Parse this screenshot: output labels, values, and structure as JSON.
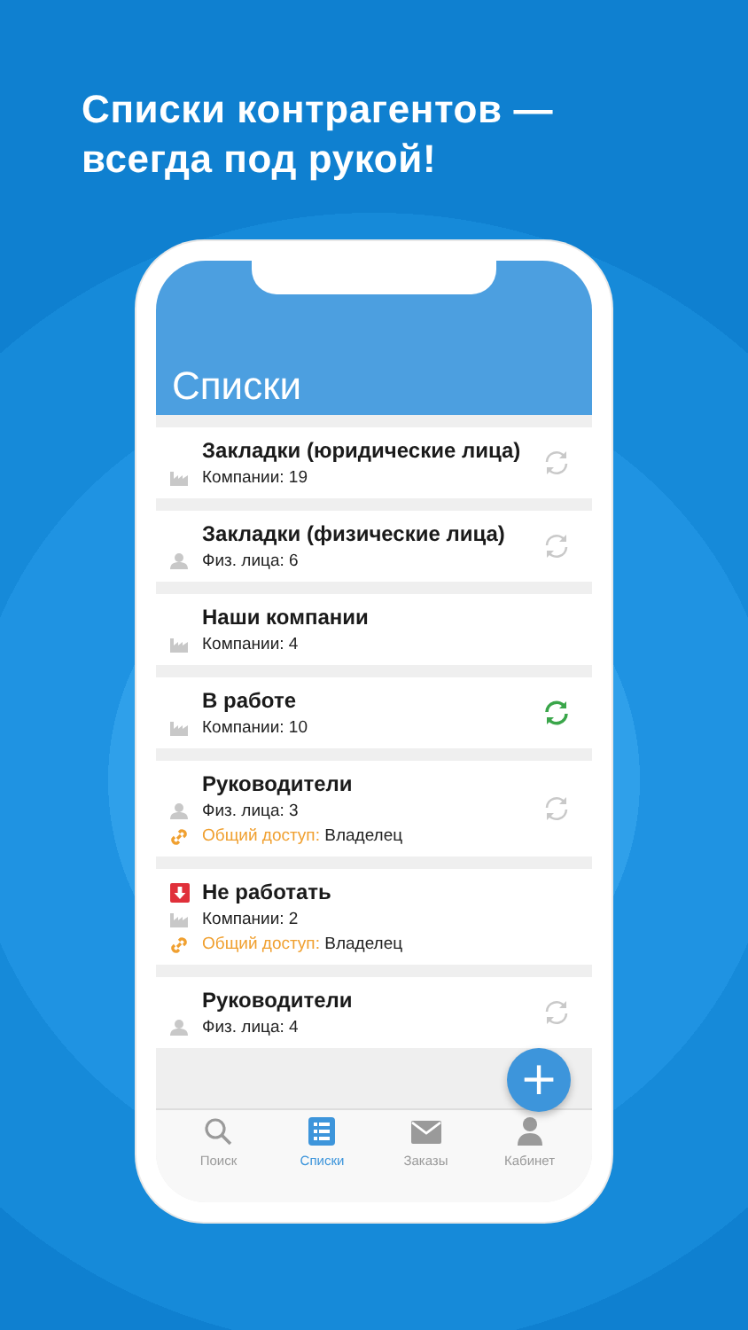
{
  "headline": [
    "Списки контрагентов —",
    "всегда под рукой!"
  ],
  "screen": {
    "title": "Списки"
  },
  "lists": [
    {
      "title": "Закладки (юридические лица)",
      "kind": "company",
      "count": "Компании: 19",
      "syncable": true,
      "synced": false,
      "flagged": false
    },
    {
      "title": "Закладки (физические лица)",
      "kind": "person",
      "count": "Физ. лица: 6",
      "syncable": true,
      "synced": false,
      "flagged": false
    },
    {
      "title": "Наши компании",
      "kind": "company",
      "count": "Компании: 4",
      "syncable": false,
      "flagged": false
    },
    {
      "title": "В работе",
      "kind": "company",
      "count": "Компании: 10",
      "syncable": true,
      "synced": true,
      "flagged": false
    },
    {
      "title": "Руководители",
      "kind": "person",
      "count": "Физ. лица: 3",
      "syncable": true,
      "synced": false,
      "flagged": false,
      "shared": {
        "label": "Общий доступ:",
        "value": "Владелец"
      }
    },
    {
      "title": "Не работать",
      "kind": "company",
      "count": "Компании: 2",
      "syncable": false,
      "flagged": true,
      "shared": {
        "label": "Общий доступ:",
        "value": "Владелец"
      }
    },
    {
      "title": "Руководители",
      "kind": "person",
      "count": "Физ. лица: 4",
      "syncable": true,
      "synced": false,
      "flagged": false
    }
  ],
  "add_button": {
    "label": "+"
  },
  "tabs": [
    {
      "label": "Поиск",
      "selected": false
    },
    {
      "label": "Списки",
      "selected": true
    },
    {
      "label": "Заказы",
      "selected": false
    },
    {
      "label": "Кабинет",
      "selected": false
    }
  ]
}
